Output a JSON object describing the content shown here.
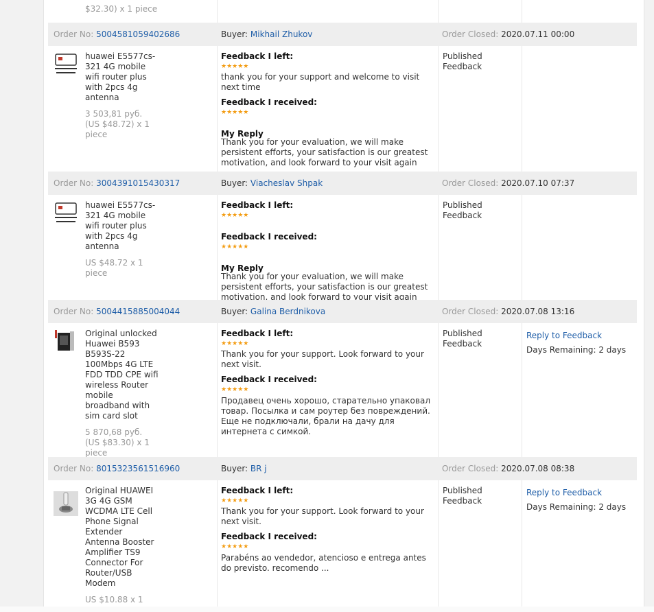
{
  "labels": {
    "order_no": "Order No:",
    "buyer": "Buyer:",
    "order_closed": "Order Closed:",
    "feedback_left": "Feedback I left:",
    "feedback_received": "Feedback I received:",
    "my_reply": "My Reply",
    "status": "Published Feedback",
    "reply_link": "Reply to Feedback",
    "days_remaining": "Days Remaining: 2 days",
    "stars": "★★★★★"
  },
  "top_fragment": "$32.30) x 1 piece",
  "orders": [
    {
      "order_no": "5004581059402686",
      "buyer": "Mikhail Zhukov",
      "closed": "2020.07.11 00:00",
      "product": "huawei E5577cs-321 4G mobile wifi router plus with 2pcs 4g antenna",
      "price": "3 503,81 руб. (US $48.72) x 1 piece",
      "left_text": "thank you for your support and welcome to visit next time",
      "received_text": "",
      "reply": "Thank you for your evaluation, we will make persistent efforts, your satisfaction is our greatest motivation, and look forward to your visit again"
    },
    {
      "order_no": "3004391015430317",
      "buyer": "Viacheslav Shpak",
      "closed": "2020.07.10 07:37",
      "product": "huawei E5577cs-321 4G mobile wifi router plus with 2pcs 4g antenna",
      "price": "US $48.72 x 1 piece",
      "left_text": "",
      "received_text": "",
      "reply": "Thank you for your evaluation, we will make persistent efforts, your satisfaction is our greatest motivation, and look forward to your visit again"
    },
    {
      "order_no": "5004415885004044",
      "buyer": "Galina Berdnikova",
      "closed": "2020.07.08 13:16",
      "product": "Original unlocked Huawei B593 B593S-22 100Mbps 4G LTE FDD TDD CPE wifi wireless Router mobile broadband with sim card slot",
      "price": "5 870,68 руб. (US $83.30) x 1 piece",
      "left_text": "Thank you for your support. Look forward to your next visit.",
      "received_text": "Продавец очень хорошо, старательно упаковал товар. Посылка и сам роутер без повреждений. Еще не подключали, брали на дачу для интернета с симкой.",
      "reply": ""
    },
    {
      "order_no": "8015323561516960",
      "buyer": "BR j",
      "closed": "2020.07.08 08:38",
      "product": "Original HUAWEI 3G 4G GSM WCDMA LTE Cell Phone Signal Extender Antenna Booster Amplifier TS9 Connector For Router/USB Modem",
      "price": "US $10.88 x 1",
      "left_text": "Thank you for your support. Look forward to your next visit.",
      "received_text": "Parabéns ao vendedor, atencioso e entrega antes do previsto. recomendo ...",
      "reply": ""
    }
  ]
}
